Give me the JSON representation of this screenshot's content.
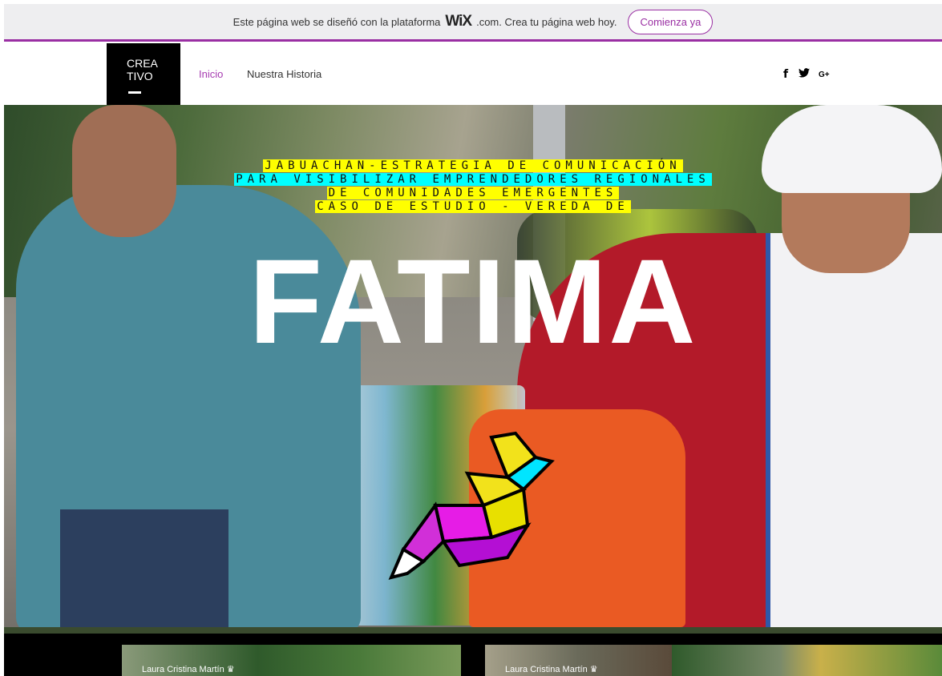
{
  "wix_banner": {
    "text": "Este página web se diseñó con la plataforma",
    "logo": "WiX",
    "dotcom": ".com. Crea tu página web hoy.",
    "cta_label": "Comienza ya",
    "accent": "#9a2fa3"
  },
  "header": {
    "logo_line1": "CREA",
    "logo_line2": "TIVO",
    "nav": [
      {
        "label": "Inicio",
        "active": true,
        "color": "#a63bb1"
      },
      {
        "label": "Nuestra Historia",
        "active": false
      }
    ],
    "social": [
      {
        "icon": "facebook-icon",
        "glyph": "f"
      },
      {
        "icon": "twitter-icon",
        "glyph": "🐦"
      },
      {
        "icon": "google-plus-icon",
        "glyph": "G+"
      }
    ]
  },
  "hero": {
    "caption_lines": [
      "JABUACHAN-ESTRATEGIA DE COMUNICACIÓN",
      "PARA VISIBILIZAR EMPRENDEDORES REGIONALES",
      "DE COMUNIDADES EMERGENTES",
      "CASO DE ESTUDIO - VEREDA DE"
    ],
    "title": "FATIMA",
    "highlight_colors": [
      "#ffff00",
      "#00ffff"
    ],
    "logo_icon": "geometric-bird-icon"
  },
  "gallery": {
    "items": [
      {
        "label": "Laura Cristina Martín ♛"
      },
      {
        "label": "Laura Cristina Martín ♛"
      },
      {
        "label": ""
      }
    ]
  }
}
